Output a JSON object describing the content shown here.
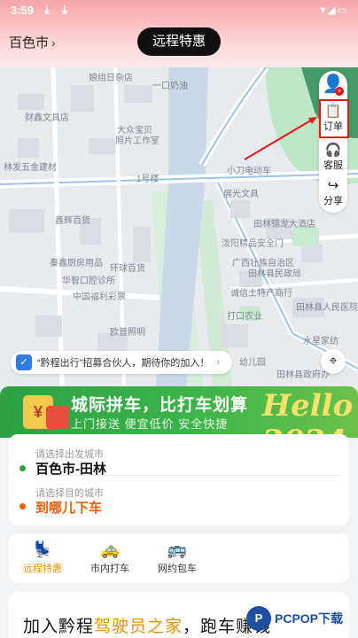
{
  "status_bar": {
    "time": "3:59"
  },
  "header": {
    "city": "百色市",
    "title": "远程特惠"
  },
  "map": {
    "labels": [
      "娘组日杂店",
      "一口奶油",
      "财鑫文具店",
      "大众宝贝",
      "照片工作室",
      "林发五金建材",
      "1号楼",
      "小刀电动车",
      "展光文具",
      "鑫辉百货",
      "田林锦龙大酒店",
      "泼阳精品安全门",
      "广西壮族自治区",
      "田林县民政局",
      "秦鑫厨房用品",
      "环球百货",
      "华智口腔诊所",
      "中国福利彩票",
      "诚信土特产商行",
      "打口农业",
      "田林县人民医院",
      "欧普照明",
      "水星家纺",
      "幼儿园",
      "田林县政府办"
    ],
    "float_panel": {
      "order_label": "订单",
      "service_label": "客服",
      "share_label": "分享"
    },
    "recruit_text": "“黔程出行”招募合伙人，期待你的加入！"
  },
  "banner": {
    "headline": "城际拼车，比打车划算",
    "subline": "上门接送  便宜低价  安全快捷",
    "hello_text": "Hello 2024"
  },
  "route": {
    "from_hint": "请选择出发城市",
    "from_value": "百色市-田林",
    "to_hint": "请选择目的城市",
    "to_value": "到哪儿下车"
  },
  "tabs": [
    {
      "label": "远程特惠",
      "icon": "seat-icon",
      "active": true
    },
    {
      "label": "市内打车",
      "icon": "taxi-icon",
      "active": false
    },
    {
      "label": "网约包车",
      "icon": "bus-icon",
      "active": false
    }
  ],
  "promo": {
    "text_prefix": "加入黔程",
    "text_highlight": "驾驶员之家",
    "text_suffix": "，跑车赚钱"
  },
  "watermark": {
    "text": "PCPOP下载"
  },
  "colors": {
    "accent": "#f29100",
    "highlight_red": "#e8151b",
    "banner_green": "#3cb54a",
    "from_dot": "#2ea043",
    "to_dot": "#f25c05"
  }
}
